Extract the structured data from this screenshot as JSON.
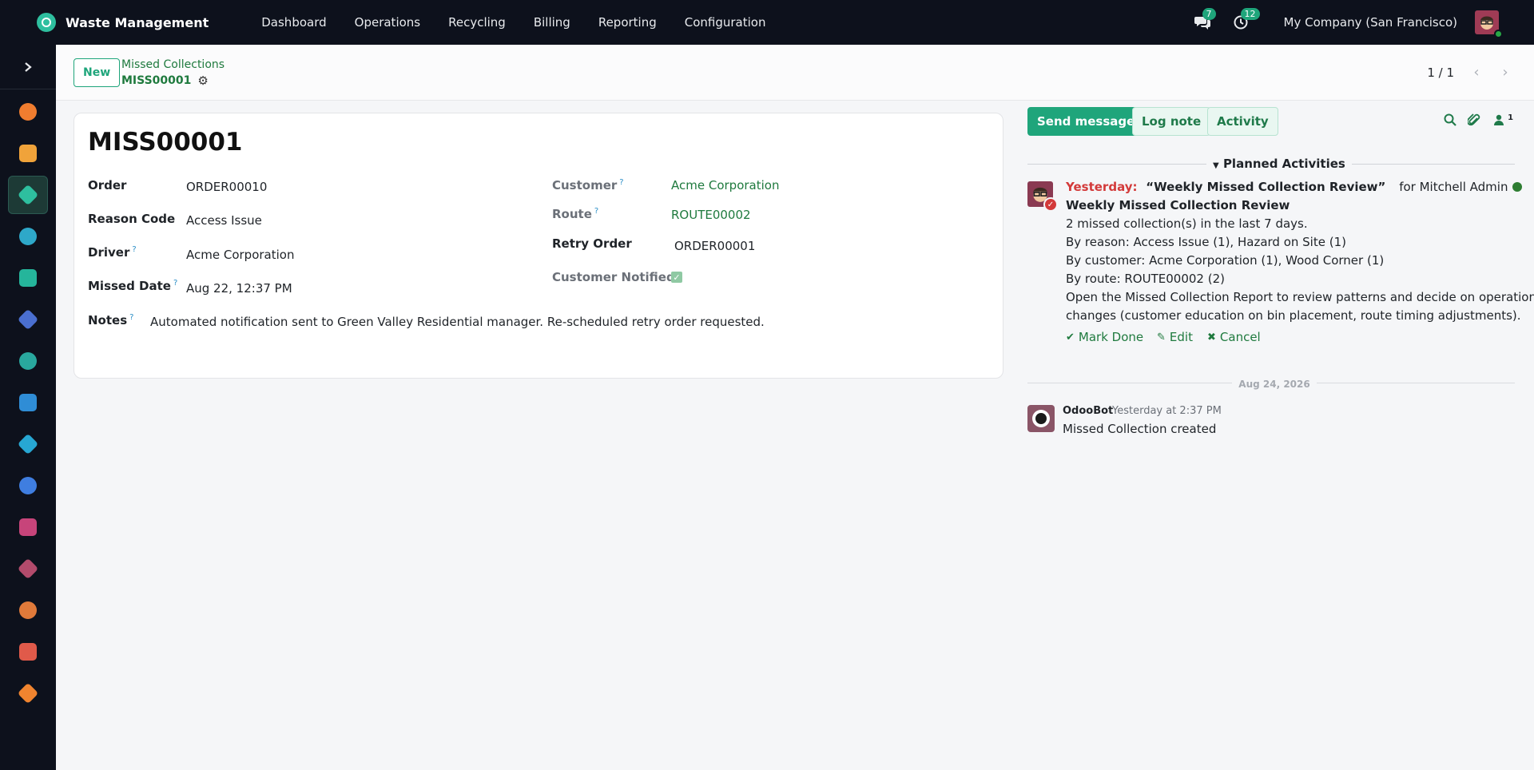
{
  "app": {
    "name": "Waste Management",
    "menu": [
      "Dashboard",
      "Operations",
      "Recycling",
      "Billing",
      "Reporting",
      "Configuration"
    ],
    "messages_count": "7",
    "activities_count": "12",
    "company": "My Company (San Francisco)"
  },
  "sidebar": {
    "apps": [
      {
        "name": "discuss",
        "color": "#f07d2f"
      },
      {
        "name": "calendar",
        "color": "#f0a33a"
      },
      {
        "name": "waste-management",
        "color": "#2ebf9f"
      },
      {
        "name": "contacts",
        "color": "#2ea8c9"
      },
      {
        "name": "crm",
        "color": "#25b59b"
      },
      {
        "name": "dashboards",
        "color": "#4a6fd0"
      },
      {
        "name": "employees",
        "color": "#29a89e"
      },
      {
        "name": "invoicing",
        "color": "#2f8dd6"
      },
      {
        "name": "website",
        "color": "#27a7d3"
      },
      {
        "name": "project",
        "color": "#3f7ee0"
      },
      {
        "name": "inventory",
        "color": "#c7447a"
      },
      {
        "name": "fleet",
        "color": "#b34b6c"
      },
      {
        "name": "sales",
        "color": "#e07a3a"
      },
      {
        "name": "planning",
        "color": "#e05a4a"
      },
      {
        "name": "apps",
        "color": "#f0842f"
      }
    ]
  },
  "control_panel": {
    "new_label": "New",
    "breadcrumb_parent": "Missed Collections",
    "breadcrumb_current": "MISS00001",
    "pager": "1 / 1"
  },
  "record": {
    "title": "MISS00001",
    "labels": {
      "order": "Order",
      "reason_code": "Reason Code",
      "driver": "Driver",
      "missed_date": "Missed Date",
      "notes": "Notes",
      "customer": "Customer",
      "route": "Route",
      "retry_order": "Retry Order",
      "customer_notified": "Customer Notified"
    },
    "tooltip_mark": "?",
    "values": {
      "order": "ORDER00010",
      "reason_code": "Access Issue",
      "driver": "Acme Corporation",
      "missed_date": "Aug 22, 12:37 PM",
      "notes": "Automated notification sent to Green Valley Residential manager. Re-scheduled retry order requested.",
      "customer": "Acme Corporation",
      "route": "ROUTE00002",
      "retry_order": "ORDER00001"
    }
  },
  "chatter": {
    "send_message": "Send message",
    "log_note": "Log note",
    "activity": "Activity",
    "followers_count": "1",
    "planned_activities_title": "Planned Activities",
    "activity_item": {
      "when": "Yesterday:",
      "name": "“Weekly Missed Collection Review”",
      "for_text": "for Mitchell Admin",
      "summary": "Weekly Missed Collection Review",
      "lines": [
        "2 missed collection(s) in the last 7 days.",
        "By reason: Access Issue (1), Hazard on Site (1)",
        "By customer: Acme Corporation (1), Wood Corner (1)",
        "By route: ROUTE00002 (2)",
        "Open the Missed Collection Report to review patterns and decide on operational",
        "changes (customer education on bin placement, route timing adjustments)."
      ],
      "mark_done": "Mark Done",
      "edit": "Edit",
      "cancel": "Cancel"
    },
    "date_separator": "Aug 24, 2026",
    "message": {
      "author": "OdooBot",
      "time": "Yesterday at 2:37 PM",
      "body": "Missed Collection created"
    }
  }
}
